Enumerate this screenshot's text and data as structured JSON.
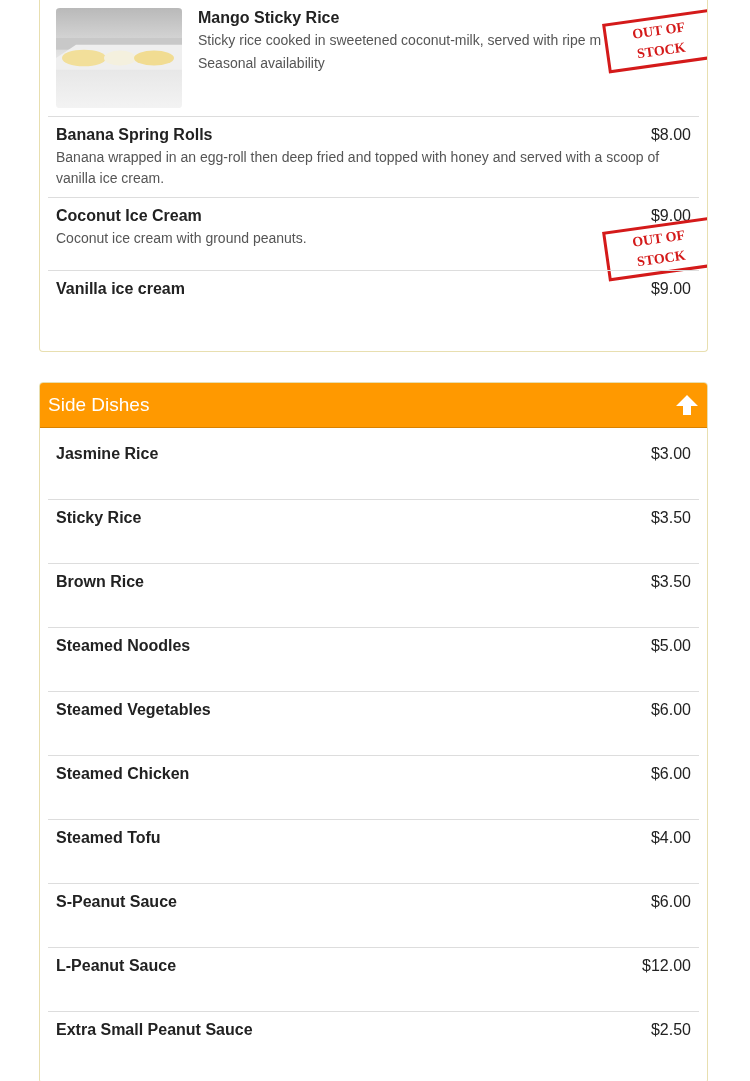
{
  "sections": [
    {
      "items": [
        {
          "name": "Mango Sticky Rice",
          "description": "Sticky rice cooked in sweetened coconut-milk, served with ripe m",
          "note": "Seasonal availability",
          "out_of_stock": true,
          "stamp": "OUT OF STOCK"
        },
        {
          "name": "Banana Spring Rolls",
          "price": "$8.00",
          "description": "Banana wrapped in an egg-roll then deep fried and topped with honey and served with a scoop of vanilla ice cream.",
          "out_of_stock": false
        },
        {
          "name": "Coconut Ice Cream",
          "price": "$9.00",
          "description": "Coconut ice cream with ground peanuts.",
          "out_of_stock": true,
          "stamp": "OUT OF STOCK"
        },
        {
          "name": "Vanilla ice cream",
          "price": "$9.00",
          "out_of_stock": false
        }
      ]
    },
    {
      "title": "Side Dishes",
      "expanded": true,
      "items": [
        {
          "name": "Jasmine Rice",
          "price": "$3.00",
          "out_of_stock": false
        },
        {
          "name": "Sticky Rice",
          "price": "$3.50",
          "out_of_stock": false
        },
        {
          "name": "Brown Rice",
          "price": "$3.50",
          "out_of_stock": false
        },
        {
          "name": "Steamed Noodles",
          "price": "$5.00",
          "out_of_stock": false
        },
        {
          "name": "Steamed Vegetables",
          "price": "$6.00",
          "out_of_stock": false
        },
        {
          "name": "Steamed Chicken",
          "price": "$6.00",
          "out_of_stock": false
        },
        {
          "name": "Steamed Tofu",
          "price": "$4.00",
          "out_of_stock": false
        },
        {
          "name": "S-Peanut Sauce",
          "price": "$6.00",
          "out_of_stock": false
        },
        {
          "name": "L-Peanut Sauce",
          "price": "$12.00",
          "out_of_stock": false
        },
        {
          "name": "Extra Small Peanut Sauce",
          "price": "$2.50",
          "out_of_stock": false
        }
      ]
    }
  ]
}
